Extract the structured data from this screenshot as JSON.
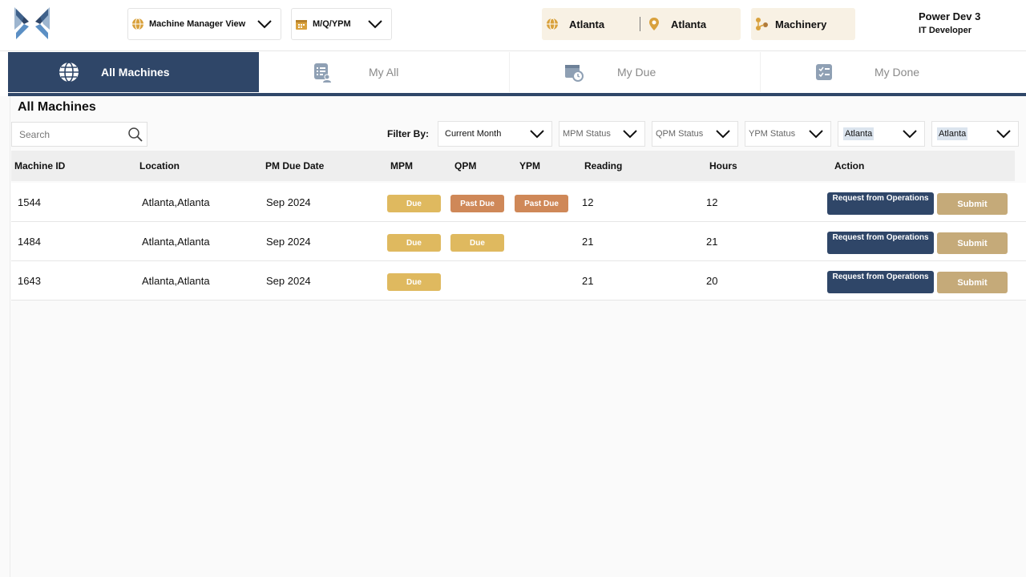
{
  "header": {
    "view_select": {
      "value": "Machine Manager View"
    },
    "period_select": {
      "value": "M/Q/YPM"
    },
    "location": {
      "city": "Atlanta",
      "site": "Atlanta"
    },
    "category": "Machinery",
    "user": {
      "name": "Power Dev 3",
      "role": "IT Developer"
    }
  },
  "tabs": [
    {
      "label": "All Machines",
      "active": true
    },
    {
      "label": "My All",
      "active": false
    },
    {
      "label": "My Due",
      "active": false
    },
    {
      "label": "My Done",
      "active": false
    }
  ],
  "page_title": "All Machines",
  "search": {
    "placeholder": "Search"
  },
  "filters": {
    "label": "Filter By:",
    "period": "Current Month",
    "mpm_status": "MPM Status",
    "qpm_status": "QPM Status",
    "ypm_status": "YPM Status",
    "location1": "Atlanta",
    "location2": "Atlanta"
  },
  "table": {
    "columns": [
      "Machine ID",
      "Location",
      "PM Due Date",
      "MPM",
      "QPM",
      "YPM",
      "Reading",
      "Hours",
      "Action"
    ],
    "rows": [
      {
        "id": "1544",
        "location": "Atlanta,Atlanta",
        "due_date": "Sep 2024",
        "mpm": "Due",
        "qpm": "Past Due",
        "ypm": "Past Due",
        "reading": "12",
        "hours": "12"
      },
      {
        "id": "1484",
        "location": "Atlanta,Atlanta",
        "due_date": "Sep 2024",
        "mpm": "Due",
        "qpm": "Due",
        "ypm": "",
        "reading": "21",
        "hours": "21"
      },
      {
        "id": "1643",
        "location": "Atlanta,Atlanta",
        "due_date": "Sep 2024",
        "mpm": "Due",
        "qpm": "",
        "ypm": "",
        "reading": "21",
        "hours": "20"
      }
    ],
    "actions": {
      "request_label": "Request from Operations",
      "submit_label": "Submit"
    }
  },
  "colors": {
    "primary": "#2f4668",
    "due": "#dfb95f",
    "past_due": "#cf8858",
    "submit": "#c5aa79",
    "highlight_box": "#f8f1e4"
  }
}
